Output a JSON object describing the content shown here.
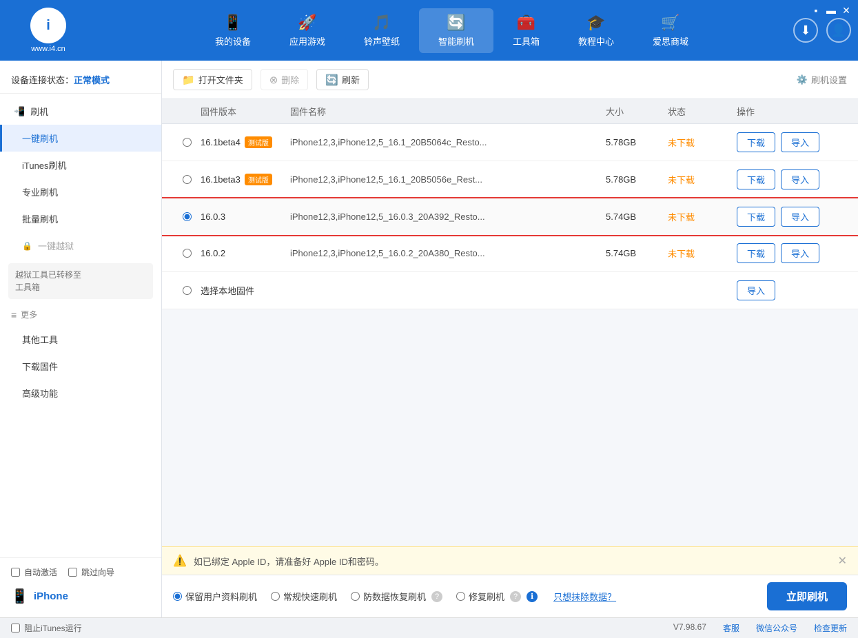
{
  "app": {
    "logo_letter": "①",
    "logo_url": "www.i4.cn",
    "window_controls": [
      "▪",
      "▬",
      "—",
      "□",
      "✕"
    ]
  },
  "nav": {
    "items": [
      {
        "id": "my-device",
        "icon": "📱",
        "label": "我的设备"
      },
      {
        "id": "apps-games",
        "icon": "🚀",
        "label": "应用游戏"
      },
      {
        "id": "ringtones",
        "icon": "🎵",
        "label": "铃声壁纸"
      },
      {
        "id": "smart-flash",
        "icon": "🔄",
        "label": "智能刷机",
        "active": true
      },
      {
        "id": "toolbox",
        "icon": "🧰",
        "label": "工具箱"
      },
      {
        "id": "tutorials",
        "icon": "🎓",
        "label": "教程中心"
      },
      {
        "id": "store",
        "icon": "🛒",
        "label": "爱思商域"
      }
    ]
  },
  "sidebar": {
    "device_status_label": "设备连接状态：",
    "device_status_value": "正常模式",
    "sections": [
      {
        "items": [
          {
            "id": "flash",
            "label": "刷机",
            "icon": "📲",
            "level": 0
          },
          {
            "id": "one-click-flash",
            "label": "一键刷机",
            "level": 1,
            "active": true
          },
          {
            "id": "itunes-flash",
            "label": "iTunes刷机",
            "level": 1
          },
          {
            "id": "pro-flash",
            "label": "专业刷机",
            "level": 1
          },
          {
            "id": "batch-flash",
            "label": "批量刷机",
            "level": 1
          },
          {
            "id": "one-click-jailbreak",
            "label": "一键越狱",
            "level": 1,
            "locked": true
          },
          {
            "id": "jailbreak-moved",
            "label": "越狱工具已转移至\n工具箱",
            "level": 1,
            "box": true
          }
        ]
      },
      {
        "separator": "更多",
        "items": [
          {
            "id": "other-tools",
            "label": "其他工具",
            "level": 1
          },
          {
            "id": "download-firmware",
            "label": "下载固件",
            "level": 1
          },
          {
            "id": "advanced",
            "label": "高级功能",
            "level": 1
          }
        ]
      }
    ],
    "auto_activate_label": "自动激活",
    "skip_wizard_label": "跳过向导",
    "device_name": "iPhone",
    "block_itunes_label": "阻止iTunes运行"
  },
  "toolbar": {
    "open_folder_label": "打开文件夹",
    "delete_label": "删除",
    "refresh_label": "刷新",
    "settings_label": "刷机设置"
  },
  "table": {
    "headers": [
      "",
      "固件版本",
      "固件名称",
      "大小",
      "状态",
      "操作"
    ],
    "rows": [
      {
        "id": "row-1",
        "selected": false,
        "version": "16.1beta4",
        "is_beta": true,
        "beta_label": "测试版",
        "filename": "iPhone12,3,iPhone12,5_16.1_20B5064c_Resto...",
        "size": "5.78GB",
        "status": "未下载",
        "actions": [
          "下载",
          "导入"
        ]
      },
      {
        "id": "row-2",
        "selected": false,
        "version": "16.1beta3",
        "is_beta": true,
        "beta_label": "测试版",
        "filename": "iPhone12,3,iPhone12,5_16.1_20B5056e_Rest...",
        "size": "5.78GB",
        "status": "未下载",
        "actions": [
          "下载",
          "导入"
        ]
      },
      {
        "id": "row-3",
        "selected": true,
        "version": "16.0.3",
        "is_beta": false,
        "filename": "iPhone12,3,iPhone12,5_16.0.3_20A392_Resto...",
        "size": "5.74GB",
        "status": "未下载",
        "actions": [
          "下载",
          "导入"
        ]
      },
      {
        "id": "row-4",
        "selected": false,
        "version": "16.0.2",
        "is_beta": false,
        "filename": "iPhone12,3,iPhone12,5_16.0.2_20A380_Resto...",
        "size": "5.74GB",
        "status": "未下载",
        "actions": [
          "下载",
          "导入"
        ]
      },
      {
        "id": "row-local",
        "selected": false,
        "version": "选择本地固件",
        "is_beta": false,
        "filename": "",
        "size": "",
        "status": "",
        "actions": [
          "导入"
        ]
      }
    ]
  },
  "notice": {
    "text": "如已绑定 Apple ID，请准备好 Apple ID和密码。"
  },
  "flash_options": {
    "options": [
      {
        "id": "keep-data",
        "label": "保留用户资料刷机",
        "selected": true
      },
      {
        "id": "quick-flash",
        "label": "常规快速刷机",
        "selected": false
      },
      {
        "id": "recovery",
        "label": "防数据恢复刷机",
        "selected": false
      },
      {
        "id": "repair",
        "label": "修复刷机",
        "selected": false
      }
    ],
    "link_label": "只想抹除数据？",
    "flash_btn_label": "立即刷机"
  },
  "status_bar": {
    "block_itunes_label": "阻止iTunes运行",
    "version": "V7.98.67",
    "customer_service": "客服",
    "wechat": "微信公众号",
    "check_update": "检查更新"
  }
}
